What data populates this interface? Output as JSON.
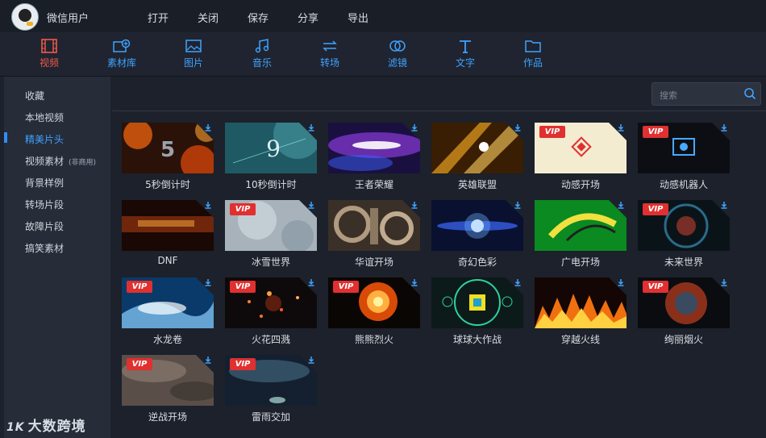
{
  "header": {
    "username": "微信用户"
  },
  "menu": [
    {
      "label": "打开"
    },
    {
      "label": "关闭"
    },
    {
      "label": "保存"
    },
    {
      "label": "分享"
    },
    {
      "label": "导出"
    }
  ],
  "tools": [
    {
      "label": "视频",
      "icon": "film-icon",
      "active": true
    },
    {
      "label": "素材库",
      "icon": "media-library-icon"
    },
    {
      "label": "图片",
      "icon": "image-icon"
    },
    {
      "label": "音乐",
      "icon": "music-icon"
    },
    {
      "label": "转场",
      "icon": "transition-icon"
    },
    {
      "label": "滤镜",
      "icon": "filter-icon"
    },
    {
      "label": "文字",
      "icon": "text-icon"
    },
    {
      "label": "作品",
      "icon": "folder-icon"
    }
  ],
  "sidebar": {
    "items": [
      {
        "label": "收藏"
      },
      {
        "label": "本地视频"
      },
      {
        "label": "精美片头",
        "active": true
      },
      {
        "label": "视频素材",
        "note": "(非商用)"
      },
      {
        "label": "背景样例"
      },
      {
        "label": "转场片段"
      },
      {
        "label": "故障片段"
      },
      {
        "label": "搞笑素材"
      }
    ]
  },
  "search": {
    "placeholder": "搜索"
  },
  "items": [
    {
      "title": "5秒倒计时",
      "vip": false,
      "art": "countdown5"
    },
    {
      "title": "10秒倒计时",
      "vip": false,
      "art": "countdown10"
    },
    {
      "title": "王者荣耀",
      "vip": false,
      "art": "purplelight"
    },
    {
      "title": "英雄联盟",
      "vip": false,
      "art": "goldrays"
    },
    {
      "title": "动感开场",
      "vip": true,
      "art": "diamond"
    },
    {
      "title": "动感机器人",
      "vip": true,
      "art": "robot"
    },
    {
      "title": "DNF",
      "vip": false,
      "art": "dnf"
    },
    {
      "title": "冰雪世界",
      "vip": true,
      "art": "snow"
    },
    {
      "title": "华谊开场",
      "vip": false,
      "art": "gears"
    },
    {
      "title": "奇幻色彩",
      "vip": false,
      "art": "bluespark"
    },
    {
      "title": "广电开场",
      "vip": false,
      "art": "green"
    },
    {
      "title": "未来世界",
      "vip": true,
      "art": "future"
    },
    {
      "title": "水龙卷",
      "vip": true,
      "art": "water"
    },
    {
      "title": "火花四溅",
      "vip": true,
      "art": "sparks"
    },
    {
      "title": "熊熊烈火",
      "vip": true,
      "art": "fireball"
    },
    {
      "title": "球球大作战",
      "vip": false,
      "art": "ball"
    },
    {
      "title": "穿越火线",
      "vip": false,
      "art": "flames"
    },
    {
      "title": "绚丽烟火",
      "vip": true,
      "art": "firework"
    },
    {
      "title": "逆战开场",
      "vip": true,
      "art": "dust"
    },
    {
      "title": "雷雨交加",
      "vip": true,
      "art": "storm"
    }
  ],
  "vip_label": "VIP",
  "watermark": {
    "logo": "1K",
    "text": "大数跨境"
  },
  "colors": {
    "accent": "#3fa3ff",
    "active": "#f05a4a",
    "vip": "#e03030"
  }
}
